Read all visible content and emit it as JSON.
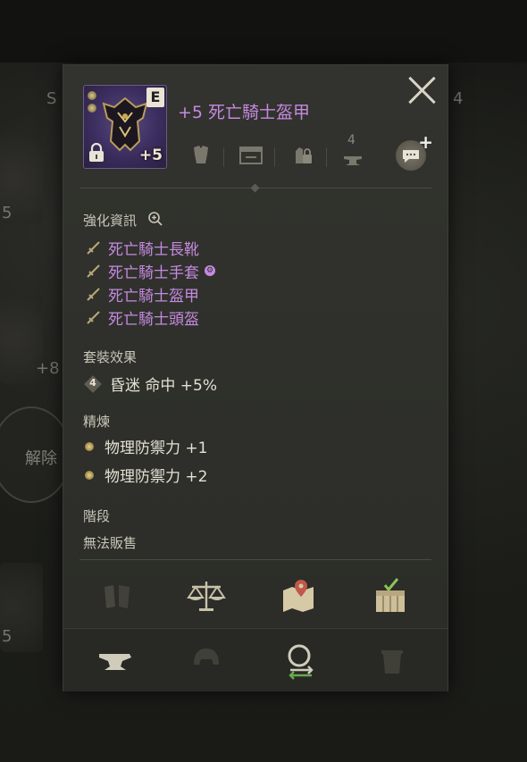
{
  "item": {
    "name": "+5 死亡騎士盔甲",
    "grade": "E",
    "plus": "+5"
  },
  "sections": {
    "enhance_title": "強化資訊",
    "set_items": [
      {
        "label": "死亡騎士長靴"
      },
      {
        "label": "死亡騎士手套"
      },
      {
        "label": "死亡騎士盔甲"
      },
      {
        "label": "死亡騎士頭盔"
      }
    ],
    "set_effect_title": "套裝效果",
    "set_effect": {
      "count": "4",
      "text": "昏迷 命中 +5%"
    },
    "refine_title": "精煉",
    "refine": [
      {
        "text": "物理防禦力 +1"
      },
      {
        "text": "物理防禦力 +2"
      }
    ],
    "tier_title": "階段",
    "tier_value": "無法販售"
  },
  "toolbar": {
    "enchant_level": "4"
  },
  "background": {
    "circle_label": "解除",
    "num_a": "5",
    "num_b": "+8",
    "num_c": "5",
    "num_d": "S",
    "num_e": "4"
  },
  "colors": {
    "item_purple": "#c48ae0",
    "panel_bg": "#30312c",
    "text_light": "#e4e1d4"
  }
}
